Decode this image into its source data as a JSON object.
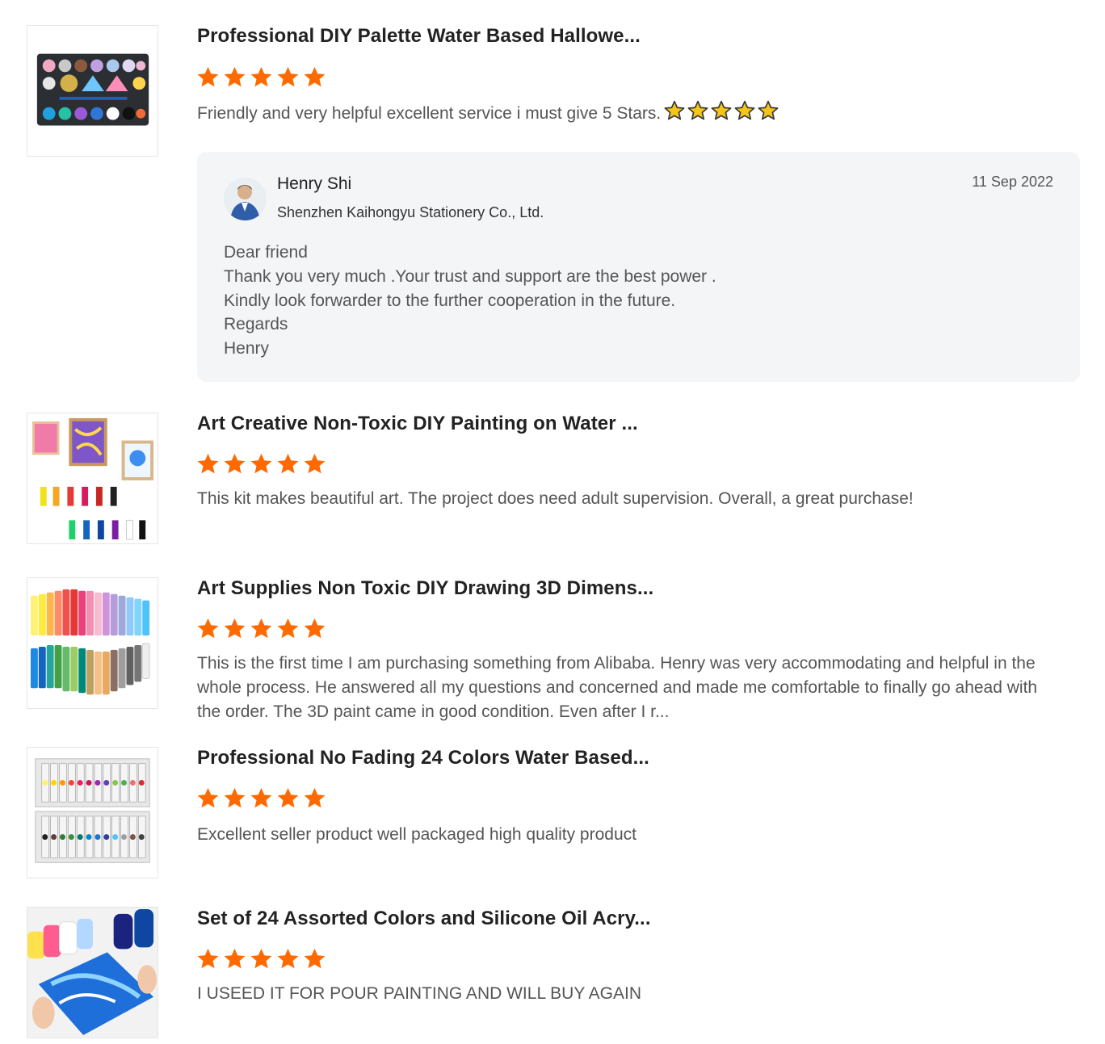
{
  "colors": {
    "star": "#ff6a00",
    "inline_star": "#f5c518",
    "reply_bg": "#f4f5f7"
  },
  "reviews": [
    {
      "title": "Professional DIY Palette Water Based Hallowe...",
      "rating": 5,
      "text": "Friendly and very helpful excellent service i must give 5 Stars.",
      "text_inline_stars": 5,
      "reply": {
        "name": "Henry Shi",
        "company": "Shenzhen Kaihongyu Stationery Co., Ltd.",
        "date": "11 Sep 2022",
        "lines": [
          "Dear friend",
          "Thank you very much .Your trust and support are the best power .",
          "Kindly look forwarder to the further cooperation in the future.",
          "Regards",
          "Henry"
        ]
      }
    },
    {
      "title": "Art Creative Non-Toxic DIY Painting on Water ...",
      "rating": 5,
      "text": "This kit makes beautiful art. The project does need adult supervision. Overall, a great purchase!"
    },
    {
      "title": "Art Supplies Non Toxic DIY Drawing 3D Dimens...",
      "rating": 5,
      "text": "This is the first time I am purchasing something from Alibaba. Henry was very accommodating and helpful in the whole process. He answered all my questions and concerned and made me comfortable to finally go ahead with the order. The 3D paint came in good condition. Even after I r..."
    },
    {
      "title": "Professional No Fading 24 Colors Water Based...",
      "rating": 5,
      "text": "Excellent seller product well packaged high quality product"
    },
    {
      "title": "Set of 24 Assorted Colors and Silicone Oil Acry...",
      "rating": 5,
      "text": "I USEED IT FOR POUR PAINTING AND WILL BUY AGAIN"
    }
  ]
}
